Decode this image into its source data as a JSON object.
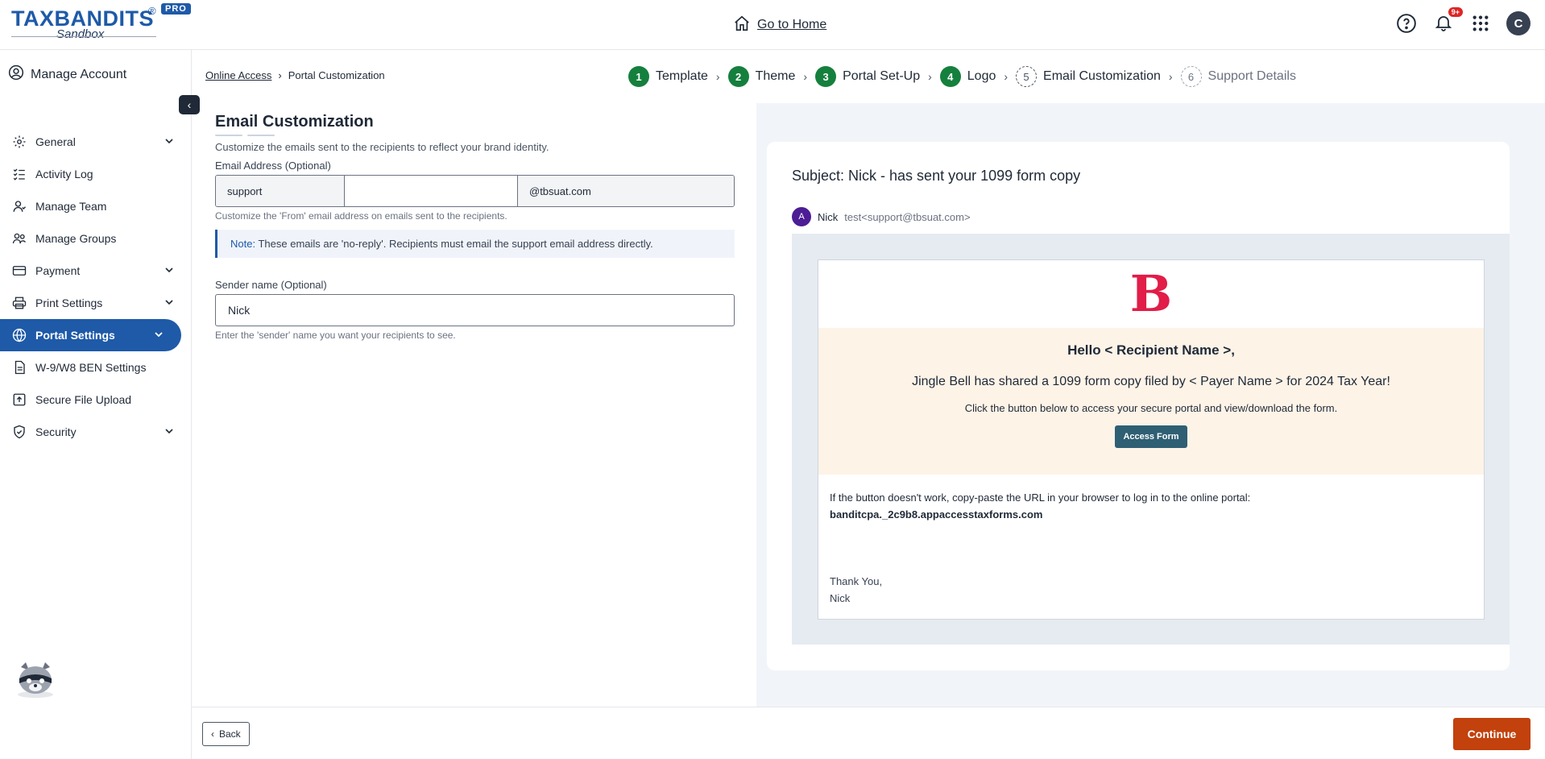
{
  "header": {
    "logo_text": "TAXBANDITS",
    "logo_reg": "®",
    "logo_badge": "PRO",
    "logo_sub": "Sandbox",
    "go_home": "Go to Home",
    "notif_badge": "9+",
    "avatar_letter": "C"
  },
  "sidebar": {
    "title": "Manage Account",
    "items": [
      {
        "label": "General",
        "icon": "gear-icon",
        "has_chevron": true
      },
      {
        "label": "Activity Log",
        "icon": "checklist-icon",
        "has_chevron": false
      },
      {
        "label": "Manage Team",
        "icon": "user-icon",
        "has_chevron": false
      },
      {
        "label": "Manage Groups",
        "icon": "users-icon",
        "has_chevron": false
      },
      {
        "label": "Payment",
        "icon": "card-icon",
        "has_chevron": true
      },
      {
        "label": "Print Settings",
        "icon": "printer-icon",
        "has_chevron": true
      },
      {
        "label": "Portal Settings",
        "icon": "globe-icon",
        "has_chevron": true,
        "active": true
      },
      {
        "label": "W-9/W8 BEN Settings",
        "icon": "document-icon",
        "has_chevron": false
      },
      {
        "label": "Secure File Upload",
        "icon": "upload-icon",
        "has_chevron": false
      },
      {
        "label": "Security",
        "icon": "shield-icon",
        "has_chevron": true
      }
    ]
  },
  "breadcrumb": {
    "link": "Online Access",
    "current": "Portal Customization"
  },
  "steps": [
    {
      "num": "1",
      "label": "Template",
      "state": "done"
    },
    {
      "num": "2",
      "label": "Theme",
      "state": "done"
    },
    {
      "num": "3",
      "label": "Portal Set-Up",
      "state": "done"
    },
    {
      "num": "4",
      "label": "Logo",
      "state": "done"
    },
    {
      "num": "5",
      "label": "Email Customization",
      "state": "current"
    },
    {
      "num": "6",
      "label": "Support Details",
      "state": "pending"
    }
  ],
  "form": {
    "title": "Email Customization",
    "description": "Customize the emails sent to the recipients to reflect your brand identity.",
    "email_label": "Email Address (Optional)",
    "email_prefix": "support",
    "email_middle": "",
    "email_domain": "@tbsuat.com",
    "email_help": "Customize the 'From' email address on emails sent to the recipients.",
    "note_label": "Note:",
    "note_text": "These emails are 'no-reply'. Recipients must email the support email address directly.",
    "sender_label": "Sender name (Optional)",
    "sender_value": "Nick",
    "sender_help": "Enter the 'sender' name you want your recipients to see."
  },
  "preview": {
    "subject": "Subject: Nick - has sent your 1099 form copy",
    "from_initial": "A",
    "from_name": "Nick",
    "from_email": "test<support@tbsuat.com>",
    "logo_letter": "B",
    "hello": "Hello < Recipient Name >,",
    "shared": "Jingle Bell has shared a 1099 form copy filed by < Payer Name > for 2024 Tax Year!",
    "click": "Click the button below to access your secure portal and view/download the form.",
    "access_button": "Access Form",
    "fallback": "If the button doesn't work, copy-paste the URL in your browser to log in to the online portal:",
    "url": "banditcpa._2c9b8.appaccesstaxforms.com",
    "thanks": "Thank You,",
    "signature": "Nick"
  },
  "footer": {
    "back": "Back",
    "continue": "Continue"
  },
  "colors": {
    "primary": "#1e5aa8",
    "step_done": "#15803d",
    "continue": "#c2410c",
    "access_button": "#2f5f73",
    "hero_bg": "#fdf3e7",
    "brand_logo": "#e11d48"
  }
}
